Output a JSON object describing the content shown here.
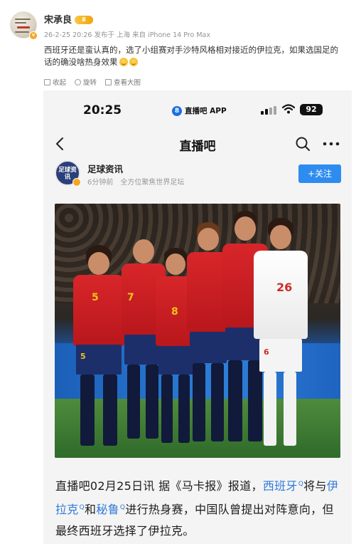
{
  "post": {
    "user_name": "宋承良",
    "level_badge": "8",
    "meta": "26-2-25 20:26 发布于 上海 来自 iPhone 14 Pro Max",
    "text_line1": "西班牙还是蛮认真的，选了小组赛对手沙特风格相对接近的伊拉克，如果选国足的",
    "text_line2": "话的确没啥热身效果",
    "toolbar": {
      "collapse": "收起",
      "rotate": "旋转",
      "view_large": "查看大图"
    }
  },
  "screenshot": {
    "status": {
      "time": "20:25",
      "app_tag": "直播吧 APP",
      "app_logo": "8",
      "battery": "92"
    },
    "nav": {
      "title": "直播吧"
    },
    "source": {
      "avatar_text": "足球资讯",
      "name": "足球资讯",
      "time": "6分钟前",
      "desc": "全方位聚焦世界足坛",
      "follow": "+关注"
    },
    "photo": {
      "jersey_numbers": [
        "5",
        "7",
        "8",
        "5",
        "26",
        "6"
      ]
    },
    "article": {
      "part1": "直播吧02月25日讯 据《马卡报》报道，",
      "link1": "西班牙",
      "part2": "将与",
      "link2": "伊拉克",
      "part3": "和",
      "link3": "秘鲁",
      "part4": "进行热身赛，中国队曾提出对阵意向，但最终西班牙选择了伊拉克。"
    }
  }
}
